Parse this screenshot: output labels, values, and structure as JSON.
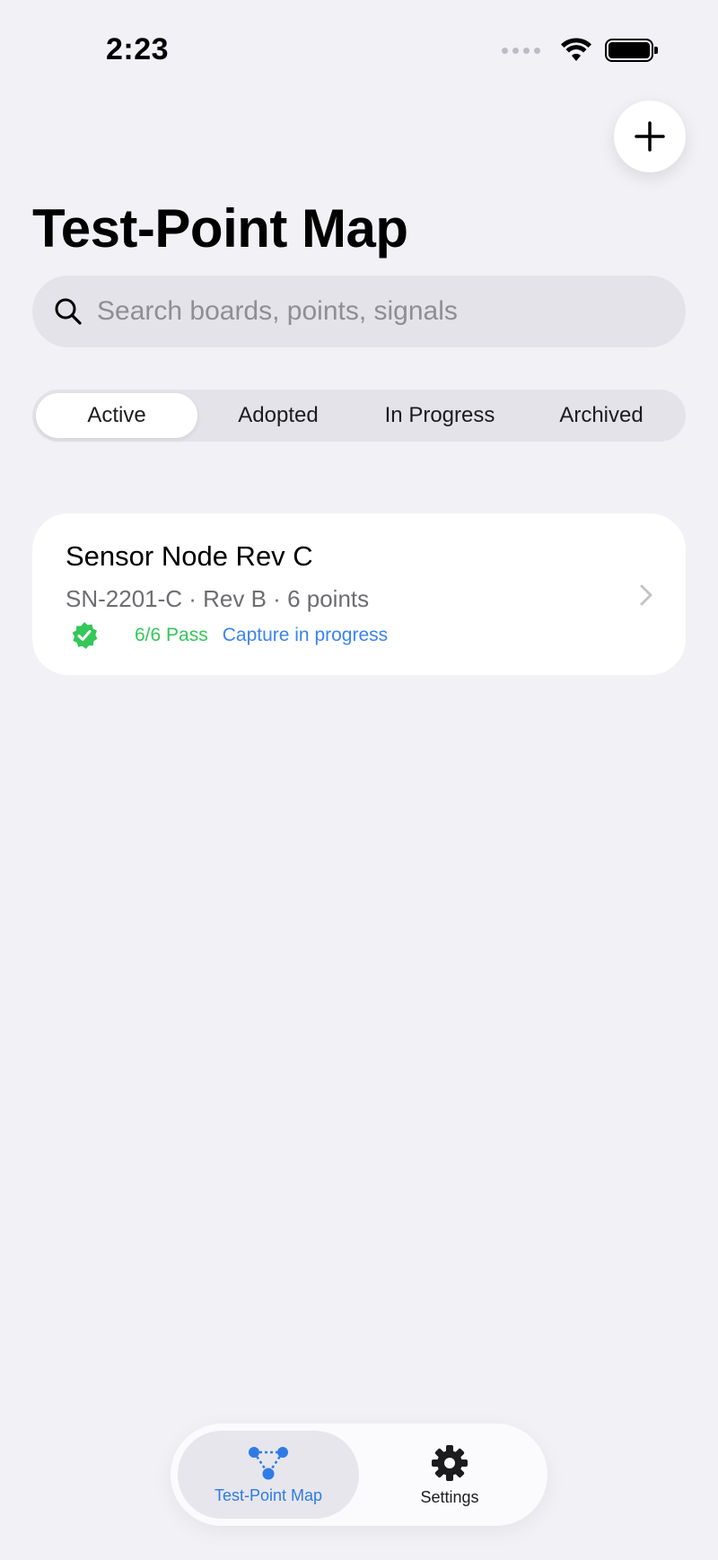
{
  "status_bar": {
    "time": "2:23"
  },
  "header": {
    "title": "Test-Point Map"
  },
  "search": {
    "placeholder": "Search boards, points, signals",
    "value": ""
  },
  "filters": {
    "selected": "Active",
    "segments": [
      "Active",
      "Adopted",
      "In Progress",
      "Archived"
    ]
  },
  "boards": [
    {
      "name": "Sensor Node Rev C",
      "details": "SN-2201-C · Rev B · 6 points",
      "pass_status": "6/6 Pass",
      "capture_status": "Capture in progress"
    }
  ],
  "tab_bar": {
    "tabs": [
      {
        "label": "Test-Point Map",
        "icon": "network-nodes-icon",
        "active": true
      },
      {
        "label": "Settings",
        "icon": "gear-icon",
        "active": false
      }
    ]
  },
  "colors": {
    "background": "#f1f1f6",
    "accent": "#2f7be6",
    "pass": "#34c759"
  }
}
